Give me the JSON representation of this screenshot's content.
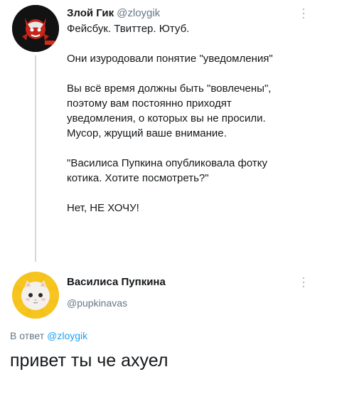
{
  "tweet": {
    "author_name": "Злой Гик",
    "author_handle": "@zloygik",
    "paragraphs": [
      "Фейсбук. Твиттер. Ютуб.",
      "Они изуродовали понятие \"уведомления\"",
      "Вы всё время должны быть \"вовлечены\",\nпоэтому вам постоянно приходят\nуведомления, о которых вы не просили.\nМусор, жрущий ваше внимание.",
      "\"Василиса Пупкина опубликовала фотку\nкотика. Хотите посмотреть?\"",
      "Нет, НЕ ХОЧУ!"
    ]
  },
  "reply": {
    "author_name": "Василиса Пупкина",
    "author_handle": "@pupkinavas",
    "reply_prefix": "В ответ",
    "reply_mention": "@zloygik",
    "text": "привет ты че ахуел"
  },
  "colors": {
    "link": "#1da1f2",
    "secondary_text": "#657786",
    "thread_line": "#cfd9de"
  },
  "icons": {
    "more": "more-vertical-icon",
    "avatar1": "red-devil-logo",
    "avatar2": "cat-in-sunflower"
  }
}
